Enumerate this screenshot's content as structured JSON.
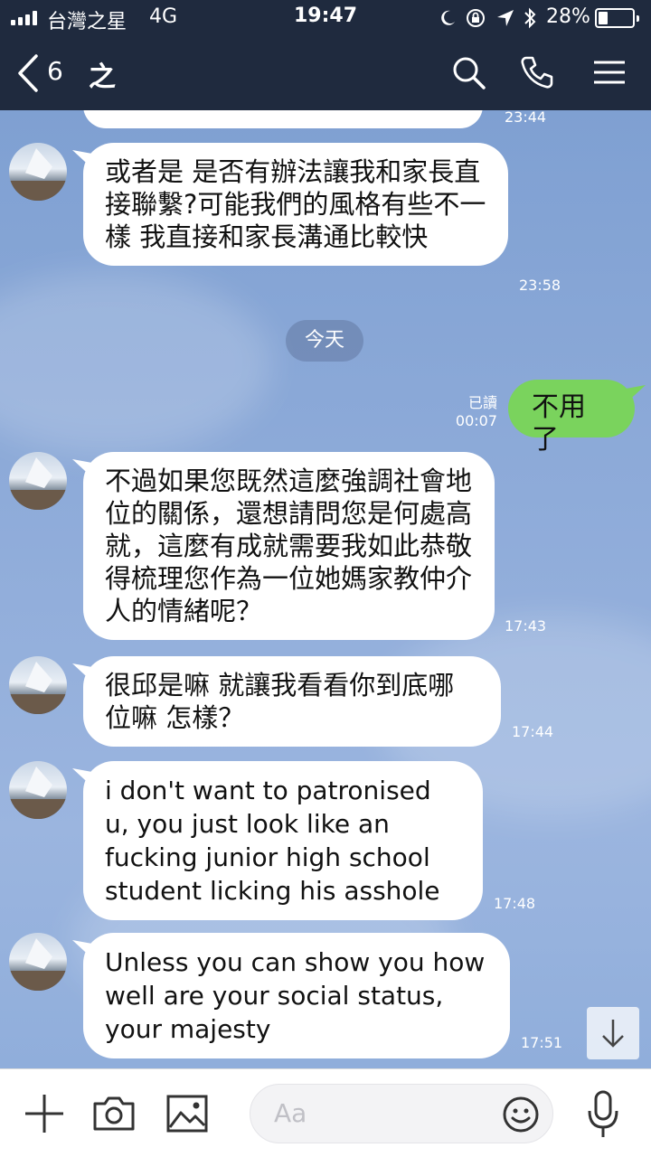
{
  "status_bar": {
    "carrier": "台灣之星",
    "network": "4G",
    "time": "19:47",
    "battery": "28%",
    "battery_level": 0.28
  },
  "header": {
    "count": "6",
    "title": "之"
  },
  "chat": {
    "partial_time": "23:44",
    "messages": [
      {
        "text": "或者是 是否有辦法讓我和家長直接聯繫?可能我們的風格有些不一樣 我直接和家長溝通比較快",
        "time": "23:58"
      },
      {
        "text": "不過如果您既然這麼強調社會地位的關係，還想請問您是何處高就，這麼有成就需要我如此恭敬得梳理您作為一位她媽家教仲介人的情緒呢？",
        "time": "17:43"
      },
      {
        "text": "很邱是嘛 就讓我看看你到底哪位嘛 怎樣？",
        "time": "17:44"
      },
      {
        "text": "i don't want to patronised u, you just look like an fucking junior high school student licking his asshole",
        "time": "17:48"
      },
      {
        "text": "Unless you can show you how well are your social status, your majesty",
        "time": "17:51"
      }
    ],
    "day_separator": "今天",
    "outgoing": {
      "text": "不用了",
      "read": "已讀",
      "time": "00:07"
    }
  },
  "footer": {
    "placeholder": "Aa"
  },
  "colors": {
    "header_bg": "#1f2a3e",
    "outgoing_bubble": "#7ad35d",
    "incoming_bubble": "#ffffff"
  }
}
